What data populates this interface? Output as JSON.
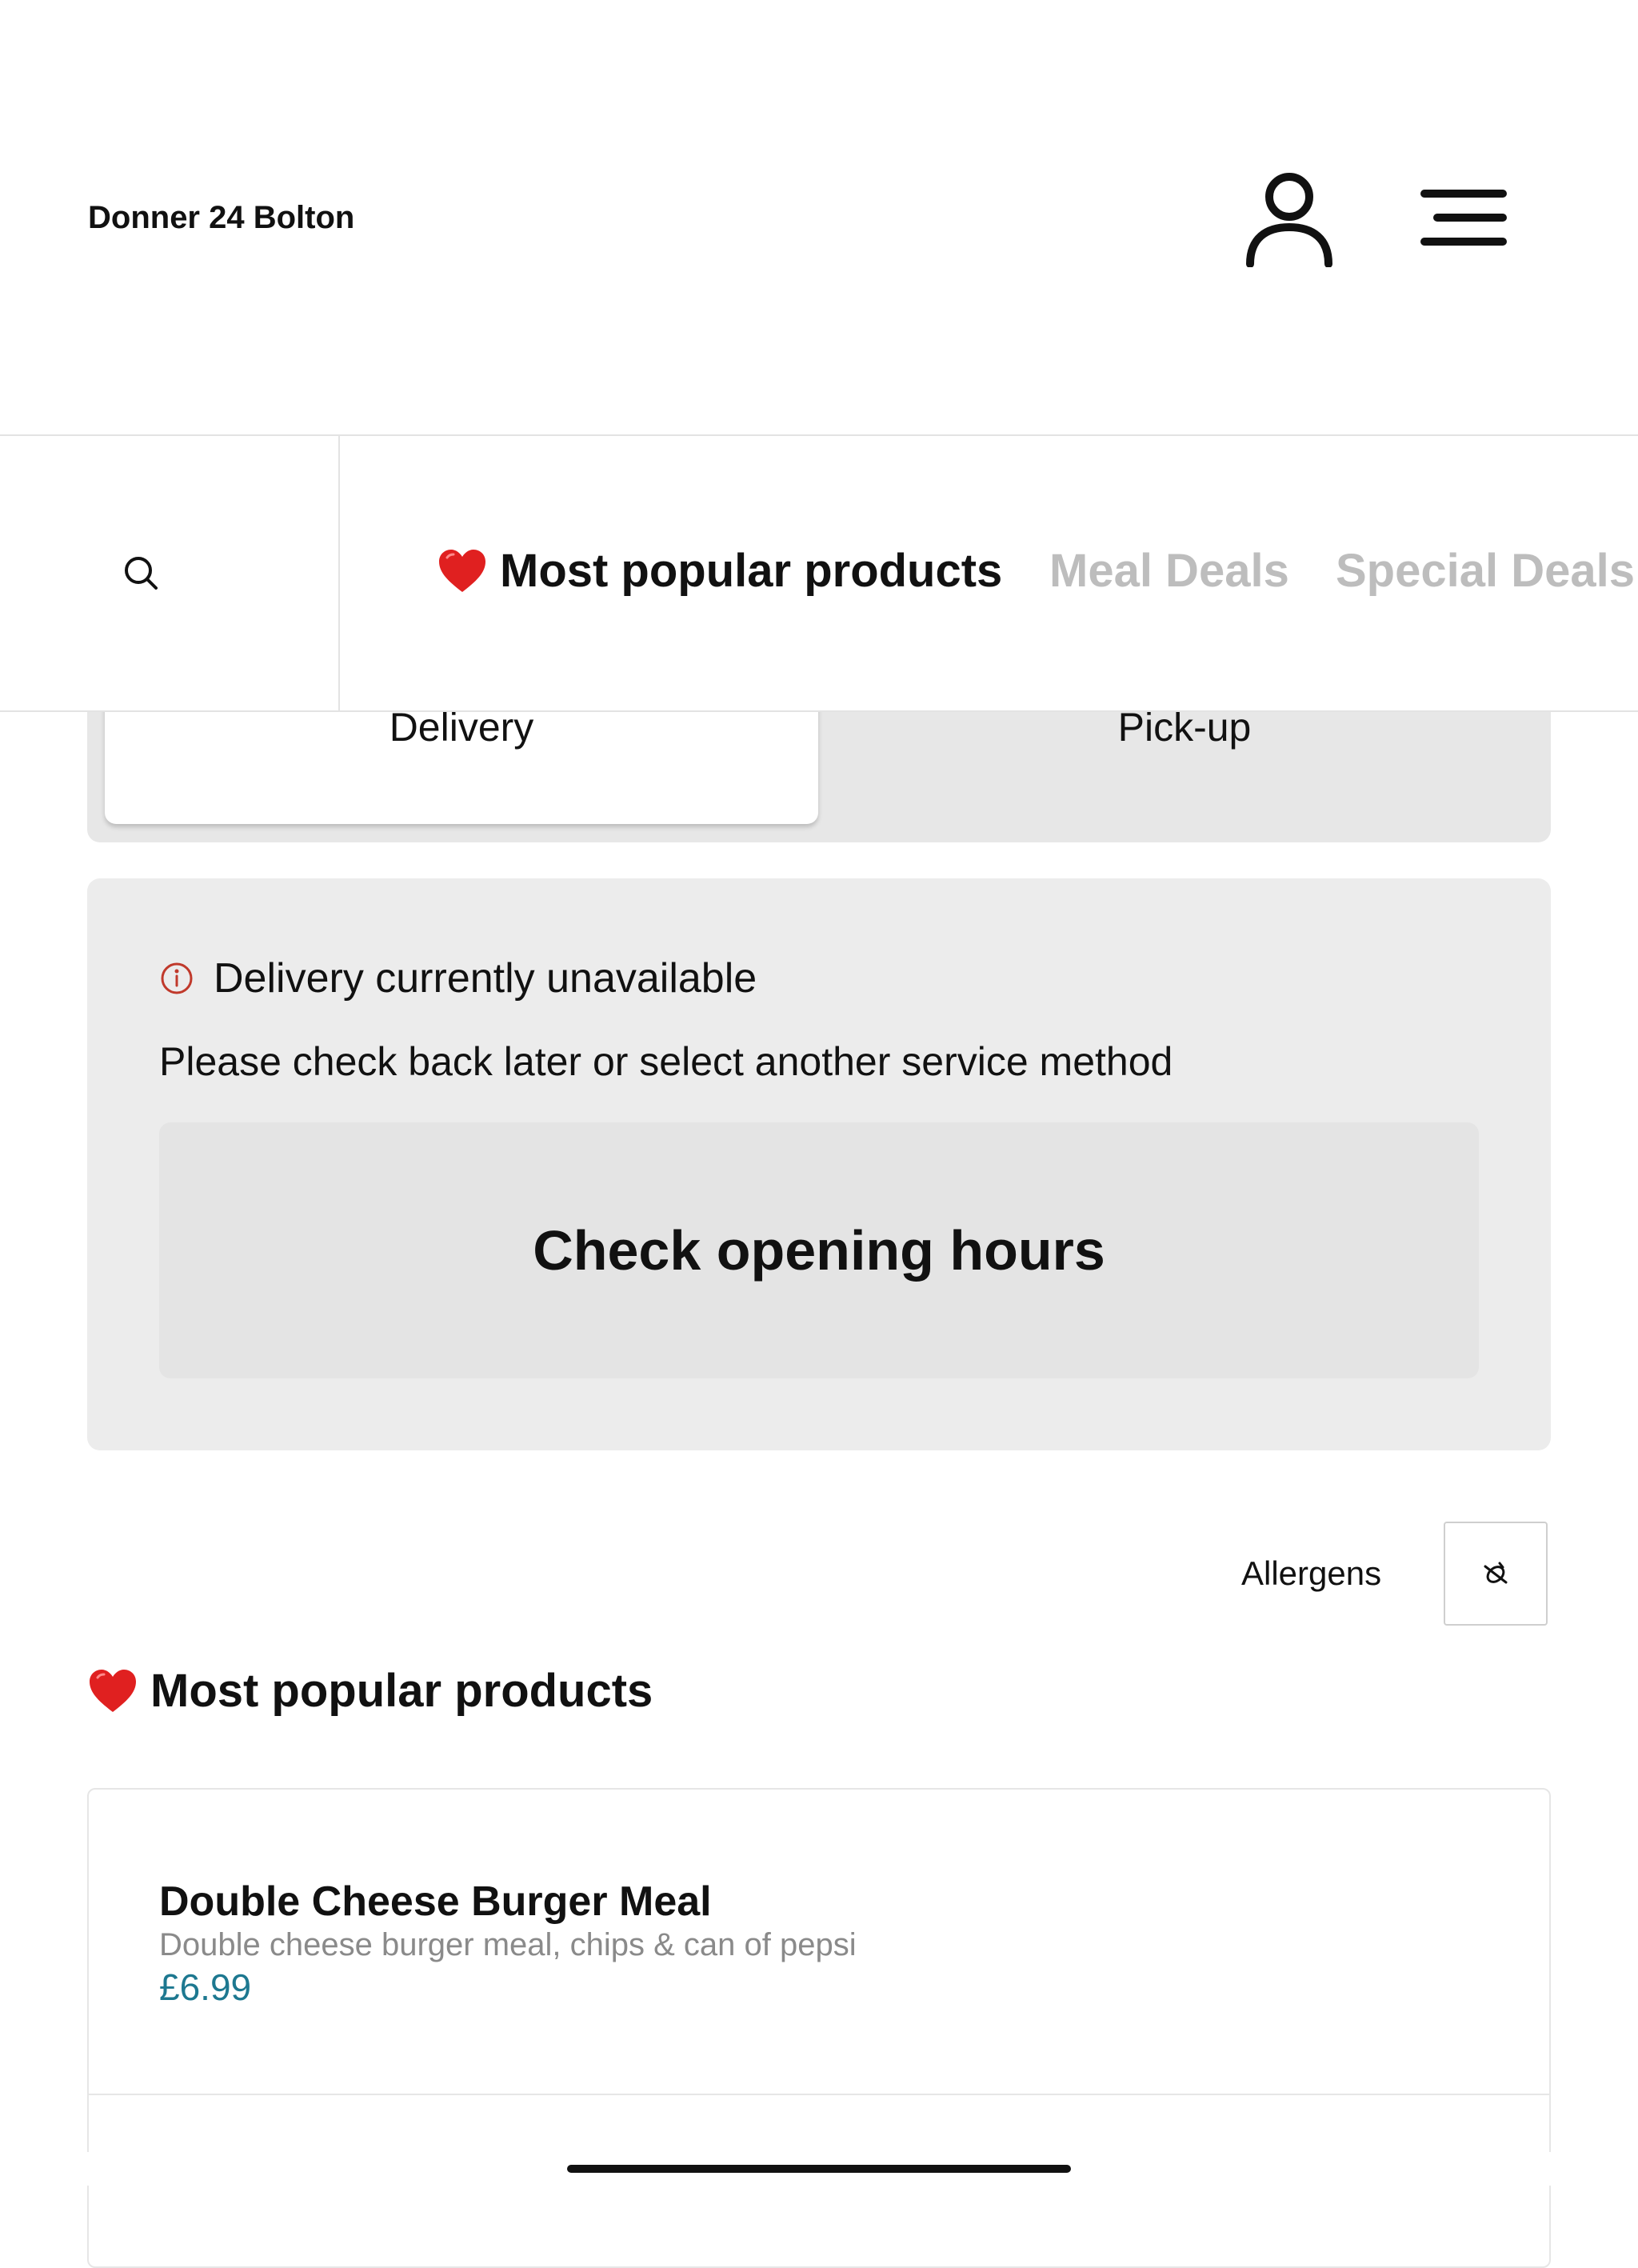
{
  "header": {
    "store_name": "Donner 24 Bolton",
    "account_icon": "user-icon",
    "menu_icon": "hamburger-menu-icon"
  },
  "nav": {
    "search_icon": "search-icon",
    "tabs": [
      {
        "label": "Most popular products",
        "icon": "heart-icon",
        "active": true
      },
      {
        "label": "Meal Deals",
        "active": false
      },
      {
        "label": "Special Deals",
        "active": false
      }
    ]
  },
  "service": {
    "delivery_label": "Delivery",
    "pickup_label": "Pick-up",
    "selected": "Delivery"
  },
  "alert": {
    "title": "Delivery currently unavailable",
    "message": "Please check back later or select another service method",
    "button_label": "Check opening hours",
    "icon": "info-icon"
  },
  "allergens": {
    "label": "Allergens",
    "icon": "allergen-icon"
  },
  "section": {
    "heading": "Most popular products",
    "icon": "heart-icon"
  },
  "products": [
    {
      "name": "Double Cheese Burger Meal",
      "description": "Double cheese burger meal, chips & can of pepsi",
      "price": "£6.99"
    }
  ],
  "colors": {
    "accent_price": "#1d7890",
    "inactive_tab": "#bdbdbd",
    "info_icon": "#c0392b",
    "heart": "#e02020"
  }
}
